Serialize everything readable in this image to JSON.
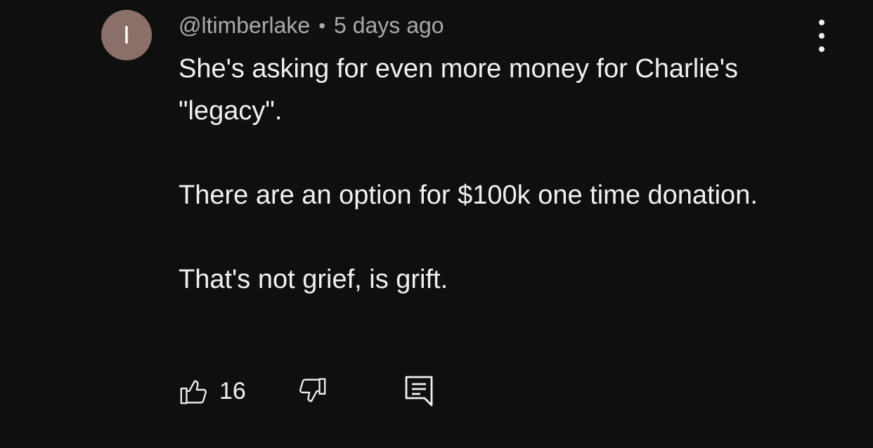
{
  "comment": {
    "avatar_letter": "I",
    "avatar_color": "#8a7068",
    "username": "@ltimberlake",
    "separator": "•",
    "timestamp": "5 days ago",
    "paragraphs": [
      "She's asking for even more money for Charlie's \"legacy\".",
      "There are an option for $100k one time donation.",
      "That's not grief, is grift."
    ],
    "like_count": "16"
  },
  "icons": {
    "more": "more-vertical-icon",
    "like": "thumbs-up-icon",
    "dislike": "thumbs-down-icon",
    "reply": "reply-comment-icon"
  }
}
